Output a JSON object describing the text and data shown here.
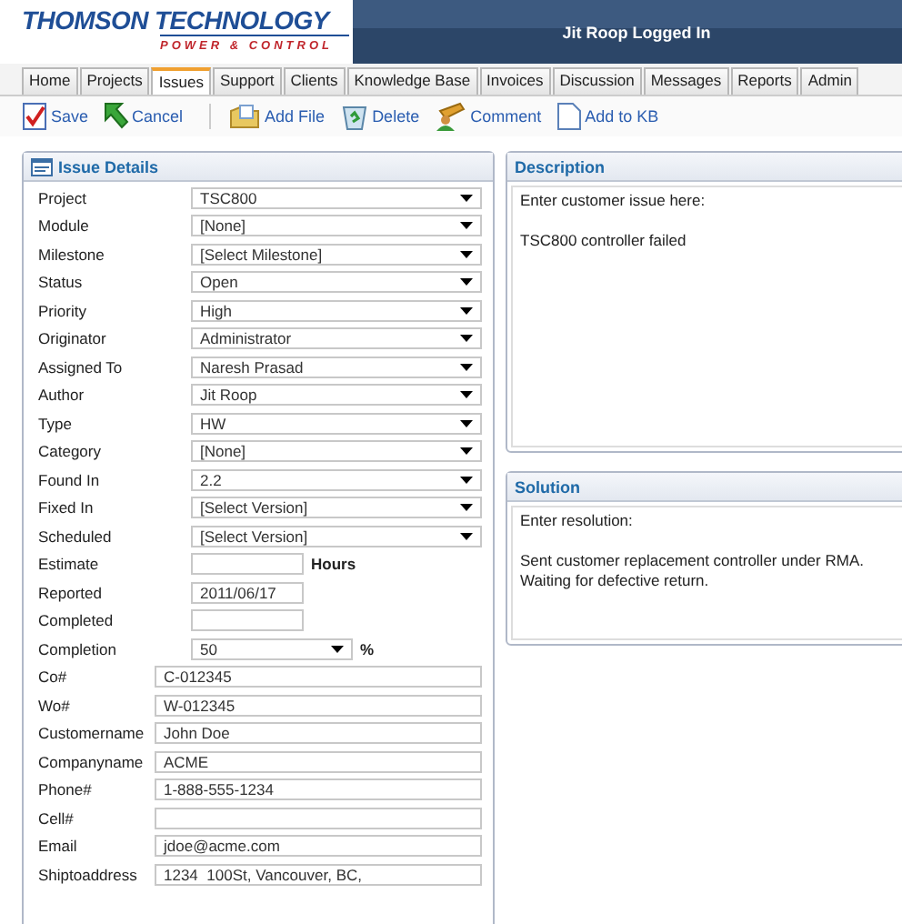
{
  "logo": {
    "name": "THOMSON TECHNOLOGY",
    "tagline": "POWER & CONTROL"
  },
  "user_status": "Jit Roop Logged In",
  "tabs": [
    {
      "label": "Home",
      "selected": false
    },
    {
      "label": "Projects",
      "selected": false
    },
    {
      "label": "Issues",
      "selected": true
    },
    {
      "label": "Support",
      "selected": false
    },
    {
      "label": "Clients",
      "selected": false
    },
    {
      "label": "Knowledge Base",
      "selected": false
    },
    {
      "label": "Invoices",
      "selected": false
    },
    {
      "label": "Discussion",
      "selected": false
    },
    {
      "label": "Messages",
      "selected": false
    },
    {
      "label": "Reports",
      "selected": false
    },
    {
      "label": "Admin",
      "selected": false
    }
  ],
  "toolbar": [
    {
      "label": "Save"
    },
    {
      "label": "Cancel"
    },
    {
      "label": "Add File"
    },
    {
      "label": "Delete"
    },
    {
      "label": "Comment"
    },
    {
      "label": "Add to KB"
    }
  ],
  "issue_details": {
    "title": "Issue Details",
    "fields": [
      {
        "label": "Project",
        "kind": "select",
        "value": "TSC800"
      },
      {
        "label": "Module",
        "kind": "select",
        "value": "[None]"
      },
      {
        "label": "Milestone",
        "kind": "select",
        "value": "[Select Milestone]"
      },
      {
        "label": "Status",
        "kind": "select",
        "value": "Open"
      },
      {
        "label": "Priority",
        "kind": "select",
        "value": "High"
      },
      {
        "label": "Originator",
        "kind": "select",
        "value": "Administrator"
      },
      {
        "label": "Assigned To",
        "kind": "select",
        "value": "Naresh Prasad"
      },
      {
        "label": "Author",
        "kind": "select",
        "value": "Jit Roop"
      },
      {
        "label": "Type",
        "kind": "select",
        "value": "HW"
      },
      {
        "label": "Category",
        "kind": "select",
        "value": "[None]"
      },
      {
        "label": "Found In",
        "kind": "select",
        "value": "2.2"
      },
      {
        "label": "Fixed In",
        "kind": "select",
        "value": "[Select Version]"
      },
      {
        "label": "Scheduled",
        "kind": "select",
        "value": "[Select Version]"
      },
      {
        "label": "Estimate",
        "kind": "short",
        "unit": "Hours"
      },
      {
        "label": "Reported",
        "kind": "short",
        "value": "2011/06/17"
      },
      {
        "label": "Completed",
        "kind": "short"
      },
      {
        "label": "Completion",
        "kind": "short_select",
        "value": "50",
        "unit": "%"
      },
      {
        "label": "Co#",
        "kind": "wide",
        "value": "C-012345"
      },
      {
        "label": "Wo#",
        "kind": "wide",
        "value": "W-012345"
      },
      {
        "label": "Customername",
        "kind": "wide",
        "value": "John Doe"
      },
      {
        "label": "Companyname",
        "kind": "wide",
        "value": "ACME"
      },
      {
        "label": "Phone#",
        "kind": "wide",
        "value": "1-888-555-1234"
      },
      {
        "label": "Cell#",
        "kind": "wide"
      },
      {
        "label": "Email",
        "kind": "wide",
        "value": "jdoe@acme.com"
      },
      {
        "label": "Shiptoaddress",
        "kind": "wide",
        "value": "1234  100St, Vancouver, BC,"
      }
    ]
  },
  "description": {
    "title": "Description",
    "paragraphs": [
      [
        "Enter customer issue here:"
      ],
      [
        "TSC800 controller failed"
      ]
    ]
  },
  "solution": {
    "title": "Solution",
    "paragraphs": [
      [
        "Enter resolution:"
      ],
      [
        "Sent customer replacement controller under RMA.",
        "Waiting for defective return."
      ]
    ]
  }
}
